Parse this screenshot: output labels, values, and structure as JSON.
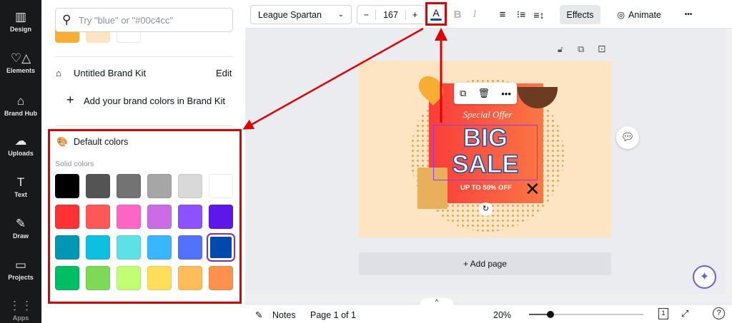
{
  "sidebar": {
    "items": [
      {
        "label": "Design",
        "icon": "▥"
      },
      {
        "label": "Elements",
        "icon": "♡△"
      },
      {
        "label": "Brand Hub",
        "icon": "⌂"
      },
      {
        "label": "Uploads",
        "icon": "☁"
      },
      {
        "label": "Text",
        "icon": "T"
      },
      {
        "label": "Draw",
        "icon": "✎"
      },
      {
        "label": "Projects",
        "icon": "▭"
      },
      {
        "label": "Apps",
        "icon": "⋮⋮"
      }
    ]
  },
  "panel": {
    "search_placeholder": "Try \"blue\" or \"#00c4cc\"",
    "recent_colors": [
      "#f9ae33",
      "#fde4c3",
      "#ffffff"
    ],
    "brand_kit": "Untitled Brand Kit",
    "edit": "Edit",
    "add_brand": "Add your brand colors in Brand Kit",
    "default_colors": "Default colors",
    "solid_colors": "Solid colors",
    "swatches": [
      [
        "#000000",
        "#545454",
        "#737373",
        "#a6a6a6",
        "#d9d9d9",
        "#ffffff"
      ],
      [
        "#ff3131",
        "#ff5757",
        "#ff66c4",
        "#cb6ce6",
        "#8c52ff",
        "#5e17eb"
      ],
      [
        "#0097b2",
        "#0cc0df",
        "#5ce1e6",
        "#38b6ff",
        "#5271ff",
        "#004aad"
      ],
      [
        "#00bf63",
        "#7ed957",
        "#c1ff72",
        "#ffde59",
        "#ffbd59",
        "#ff914d"
      ]
    ],
    "selected": "#004aad"
  },
  "toolbar": {
    "font": "League Spartan",
    "minus": "−",
    "size": "167",
    "plus": "+",
    "text_color_letter": "A",
    "bold": "B",
    "italic": "I",
    "effects": "Effects",
    "animate": "Animate",
    "more": "•••"
  },
  "design": {
    "special": "Special Offer",
    "big": "BIG",
    "sale": "SALE",
    "off": "UP TO 50% OFF"
  },
  "canvas": {
    "add_page": "+ Add page"
  },
  "bottom": {
    "notes": "Notes",
    "page": "Page 1 of 1",
    "zoom": "20%",
    "zoom_value": 20,
    "page_count": "1"
  }
}
